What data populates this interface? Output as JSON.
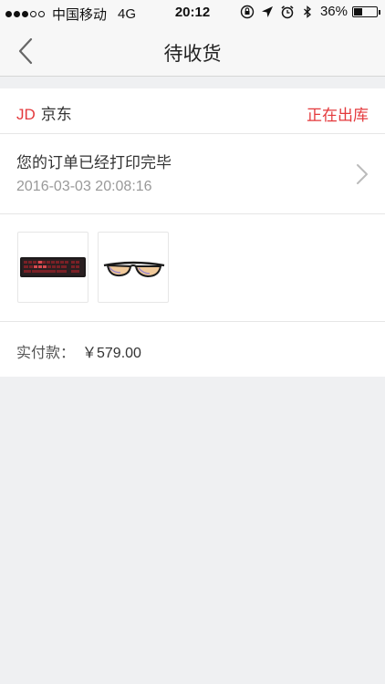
{
  "status_bar": {
    "carrier": "中国移动",
    "network": "4G",
    "time": "20:12",
    "battery": "36%",
    "battery_level": 0.36,
    "signal_bars_filled": 3,
    "signal_bars_total": 5
  },
  "navbar": {
    "title": "待收货",
    "back_icon": "chevron-left-icon"
  },
  "order": {
    "shop_logo_text": "JD",
    "shop_name": "京东",
    "status": "正在出库",
    "tracking_message": "您的订单已经打印完毕",
    "tracking_time": "2016-03-03 20:08:16",
    "products": [
      {
        "name": "keyboard",
        "icon": "keyboard-thumbnail"
      },
      {
        "name": "glasses",
        "icon": "glasses-thumbnail"
      }
    ],
    "total_label": "实付款：",
    "total_amount": "￥579.00"
  },
  "colors": {
    "accent": "#e4393c",
    "background": "#eff0f2",
    "bar": "#f7f7f7"
  }
}
